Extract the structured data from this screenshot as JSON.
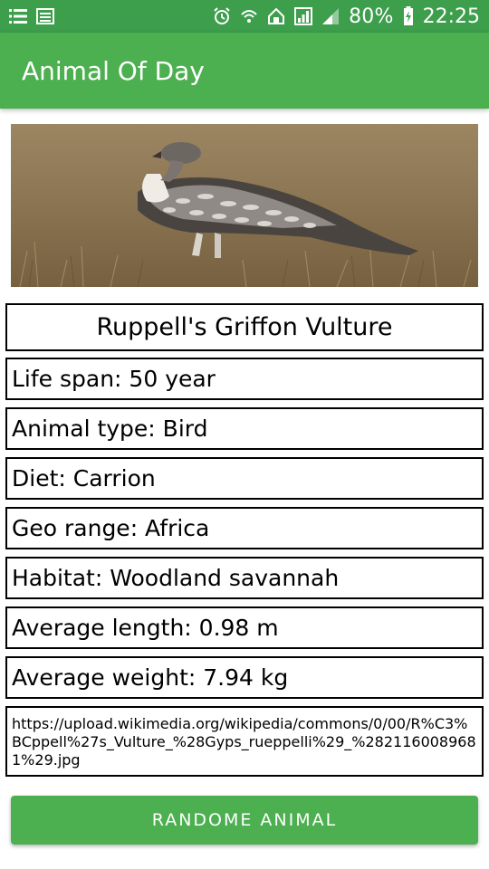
{
  "status_bar": {
    "battery": "80%",
    "time": "22:25",
    "icons": [
      "list-icon",
      "document-icon",
      "alarm-icon",
      "wifi-icon",
      "home-icon",
      "data-signal-icon",
      "cell-signal-icon",
      "battery-charging-icon"
    ]
  },
  "app_bar": {
    "title": "Animal Of Day"
  },
  "animal": {
    "name": "Ruppell's Griffon Vulture",
    "life_span": "Life span:   50 year",
    "animal_type": "Animal type: Bird",
    "diet": "Diet: Carrion",
    "geo_range": "Geo range: Africa",
    "habitat": "Habitat: Woodland savannah",
    "average_length": "Average length: 0.98 m",
    "average_weight": "Average weight: 7.94 kg",
    "image_url": "https://upload.wikimedia.org/wikipedia/commons/0/00/R%C3%BCppell%27s_Vulture_%28Gyps_rueppelli%29_%2821160089681%29.jpg"
  },
  "button": {
    "label": "RANDOME ANIMAL"
  },
  "colors": {
    "primary": "#4caf50",
    "primary_dark": "#3d9e4c"
  }
}
